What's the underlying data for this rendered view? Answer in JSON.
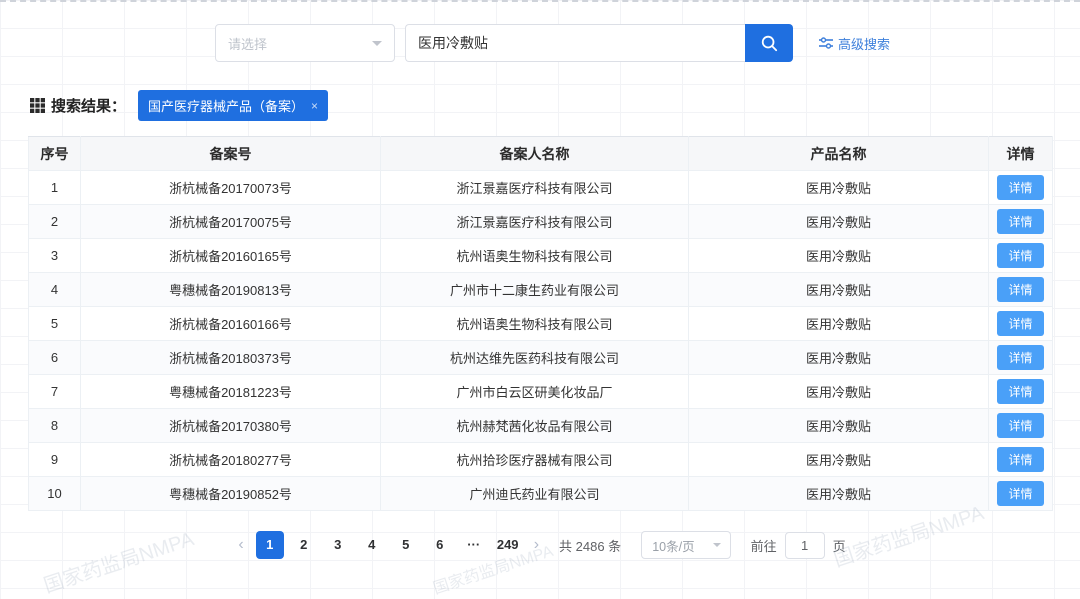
{
  "search": {
    "select_placeholder": "请选择",
    "input_value": "医用冷敷贴",
    "advanced_label": "高级搜索"
  },
  "results": {
    "label": "搜索结果：",
    "tag": "国产医疗器械产品（备案）",
    "tag_close": "×"
  },
  "table": {
    "headers": [
      "序号",
      "备案号",
      "备案人名称",
      "产品名称",
      "详情"
    ],
    "detail_label": "详情",
    "rows": [
      {
        "no": "1",
        "record_no": "浙杭械备20170073号",
        "registrant": "浙江景嘉医疗科技有限公司",
        "product": "医用冷敷贴"
      },
      {
        "no": "2",
        "record_no": "浙杭械备20170075号",
        "registrant": "浙江景嘉医疗科技有限公司",
        "product": "医用冷敷贴"
      },
      {
        "no": "3",
        "record_no": "浙杭械备20160165号",
        "registrant": "杭州语奥生物科技有限公司",
        "product": "医用冷敷贴"
      },
      {
        "no": "4",
        "record_no": "粤穗械备20190813号",
        "registrant": "广州市十二康生药业有限公司",
        "product": "医用冷敷贴"
      },
      {
        "no": "5",
        "record_no": "浙杭械备20160166号",
        "registrant": "杭州语奥生物科技有限公司",
        "product": "医用冷敷贴"
      },
      {
        "no": "6",
        "record_no": "浙杭械备20180373号",
        "registrant": "杭州达维先医药科技有限公司",
        "product": "医用冷敷贴"
      },
      {
        "no": "7",
        "record_no": "粤穗械备20181223号",
        "registrant": "广州市白云区研美化妆品厂",
        "product": "医用冷敷贴"
      },
      {
        "no": "8",
        "record_no": "浙杭械备20170380号",
        "registrant": "杭州赫梵茜化妆品有限公司",
        "product": "医用冷敷贴"
      },
      {
        "no": "9",
        "record_no": "浙杭械备20180277号",
        "registrant": "杭州拾珍医疗器械有限公司",
        "product": "医用冷敷贴"
      },
      {
        "no": "10",
        "record_no": "粤穗械备20190852号",
        "registrant": "广州迪氏药业有限公司",
        "product": "医用冷敷贴"
      }
    ]
  },
  "pagination": {
    "prev_icon": "‹",
    "next_icon": "›",
    "pages": [
      "1",
      "2",
      "3",
      "4",
      "5",
      "6",
      "···",
      "249"
    ],
    "active_page": "1",
    "total": "共 2486 条",
    "page_size": "10条/页",
    "goto_prefix": "前往",
    "goto_value": "1",
    "goto_suffix": "页"
  },
  "watermark": "国家药监局NMPA",
  "colors": {
    "primary": "#1f6fe0",
    "detail_button": "#4aa0f8",
    "link": "#3d7fdb"
  }
}
